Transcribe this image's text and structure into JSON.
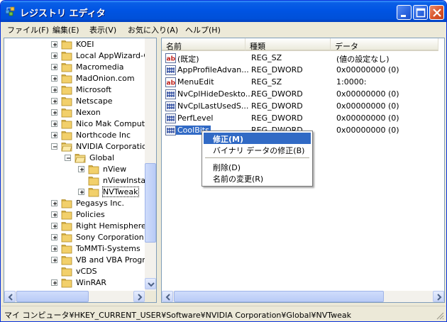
{
  "window": {
    "title": "レジストリ エディタ"
  },
  "menu": [
    {
      "label": "ファイル(F)"
    },
    {
      "label": "編集(E)"
    },
    {
      "label": "表示(V)"
    },
    {
      "label": "お気に入り(A)"
    },
    {
      "label": "ヘルプ(H)"
    }
  ],
  "tree": {
    "items": [
      {
        "label": "KOEI",
        "level": 0,
        "expander": "plus"
      },
      {
        "label": "Local AppWizard-G",
        "level": 0,
        "expander": "plus"
      },
      {
        "label": "Macromedia",
        "level": 0,
        "expander": "plus"
      },
      {
        "label": "MadOnion.com",
        "level": 0,
        "expander": "plus"
      },
      {
        "label": "Microsoft",
        "level": 0,
        "expander": "plus"
      },
      {
        "label": "Netscape",
        "level": 0,
        "expander": "plus"
      },
      {
        "label": "Nexon",
        "level": 0,
        "expander": "plus"
      },
      {
        "label": "Nico Mak Computin",
        "level": 0,
        "expander": "plus"
      },
      {
        "label": "Northcode Inc",
        "level": 0,
        "expander": "plus"
      },
      {
        "label": "NVIDIA Corporatio",
        "level": 0,
        "expander": "minus"
      },
      {
        "label": "Global",
        "level": 1,
        "expander": "minus"
      },
      {
        "label": "nView",
        "level": 2,
        "expander": "plus"
      },
      {
        "label": "nViewInsta",
        "level": 2,
        "expander": "none"
      },
      {
        "label": "NVTweak",
        "level": 2,
        "expander": "plus",
        "selected": true
      },
      {
        "label": "Pegasys Inc.",
        "level": 0,
        "expander": "plus"
      },
      {
        "label": "Policies",
        "level": 0,
        "expander": "plus"
      },
      {
        "label": "Right Hemisphere",
        "level": 0,
        "expander": "plus"
      },
      {
        "label": "Sony Corporation",
        "level": 0,
        "expander": "plus"
      },
      {
        "label": "ToMMTi-Systems",
        "level": 0,
        "expander": "plus"
      },
      {
        "label": "VB and VBA Progr",
        "level": 0,
        "expander": "plus"
      },
      {
        "label": "vCDS",
        "level": 0,
        "expander": "none"
      },
      {
        "label": "WinRAR",
        "level": 0,
        "expander": "plus"
      }
    ]
  },
  "list": {
    "headers": {
      "name": "名前",
      "type": "種類",
      "data": "データ"
    },
    "rows": [
      {
        "icon": "string-value-icon",
        "name": "(既定)",
        "type": "REG_SZ",
        "data": "(値の設定なし)"
      },
      {
        "icon": "binary-value-icon",
        "name": "AppProfileAdvan...",
        "type": "REG_DWORD",
        "data": "0x00000000 (0)"
      },
      {
        "icon": "string-value-icon",
        "name": "MenuEdit",
        "type": "REG_SZ",
        "data": "1:0000:"
      },
      {
        "icon": "binary-value-icon",
        "name": "NvCplHideDeskto...",
        "type": "REG_DWORD",
        "data": "0x00000000 (0)"
      },
      {
        "icon": "binary-value-icon",
        "name": "NvCplLastUsedS...",
        "type": "REG_DWORD",
        "data": "0x00000000 (0)"
      },
      {
        "icon": "binary-value-icon",
        "name": "PerfLevel",
        "type": "REG_DWORD",
        "data": "0x00000000 (0)"
      },
      {
        "icon": "binary-value-icon",
        "name": "CoolBits",
        "type": "REG_DWORD",
        "data": "0x00000000 (0)",
        "selected": true
      }
    ]
  },
  "context_menu": {
    "modify": "修正(M)",
    "modify_binary": "バイナリ データの修正(B)",
    "delete": "削除(D)",
    "rename": "名前の変更(R)"
  },
  "status": {
    "path": "マイ コンピュータ¥HKEY_CURRENT_USER¥Software¥NVIDIA Corporation¥Global¥NVTweak"
  },
  "colors": {
    "title_bar": "#0054e3",
    "selection": "#316ac5",
    "close_button": "#d9542b"
  }
}
